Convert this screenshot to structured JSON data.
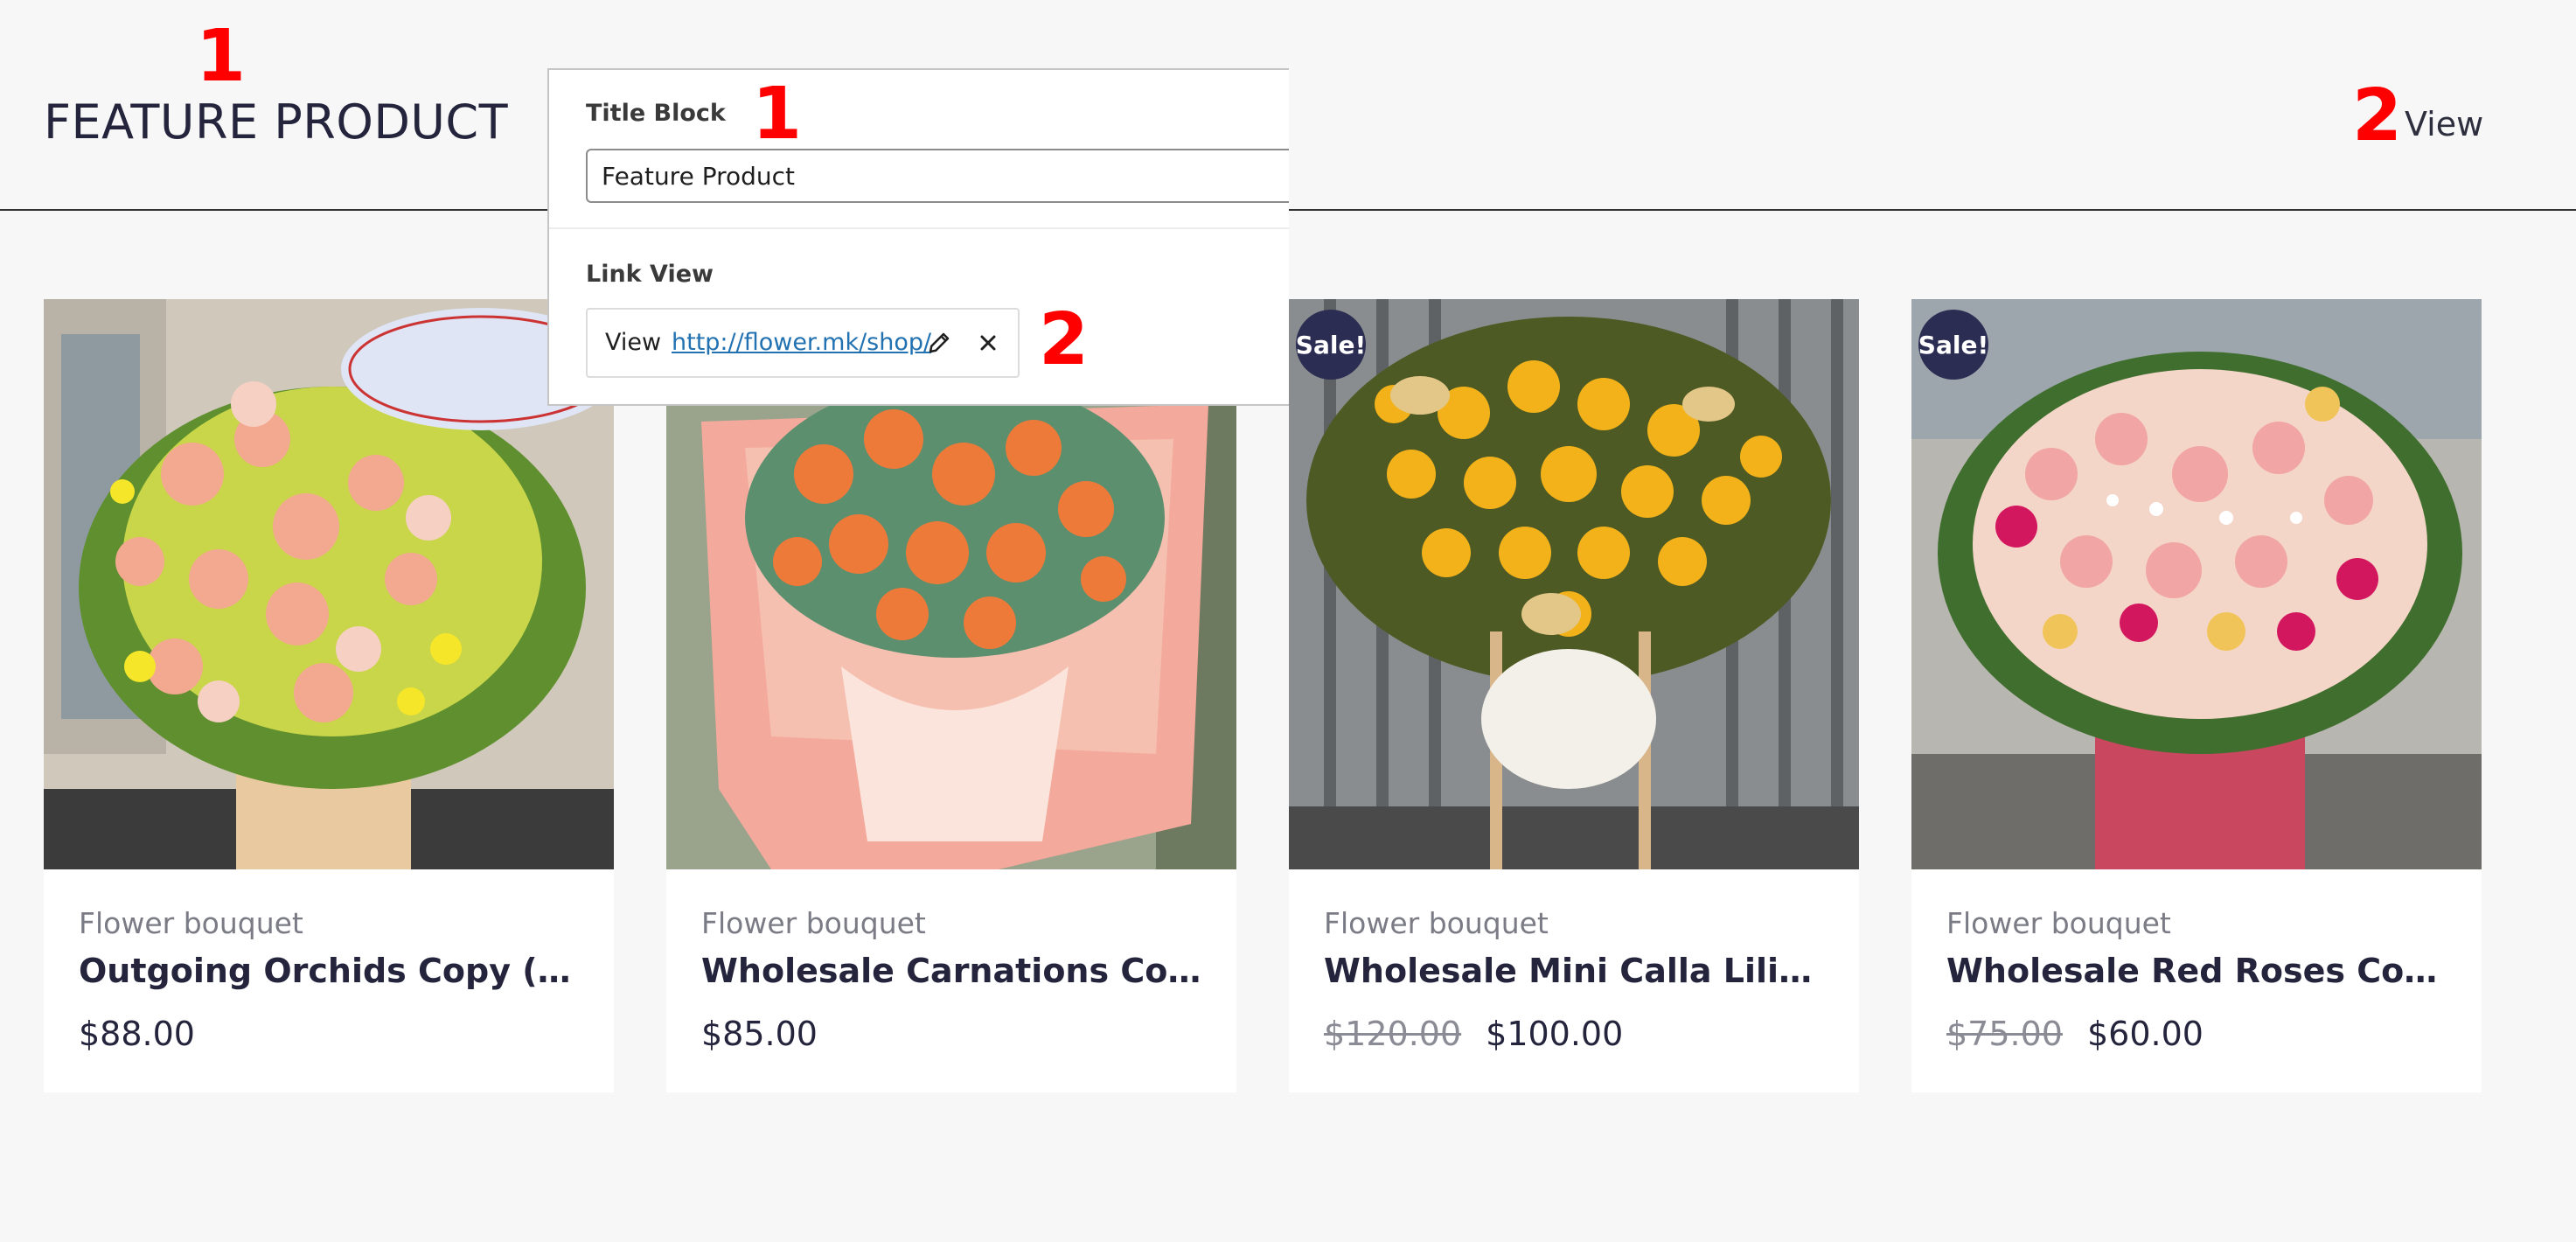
{
  "header": {
    "title": "FEATURE PRODUCT",
    "view_link": "View"
  },
  "markers": {
    "title": "1",
    "panel_title": "1",
    "view": "2",
    "panel_link": "2"
  },
  "panel": {
    "title_block_label": "Title Block",
    "title_block_value": "Feature Product",
    "link_view_label": "Link View",
    "link_prefix": "View",
    "link_url": "http://flower.mk/shop/"
  },
  "products": [
    {
      "category": "Flower bouquet",
      "name": "Outgoing Orchids Copy (Copy)",
      "old_price": "",
      "price": "$88.00",
      "sale": false,
      "image": "pink-yellow-basket"
    },
    {
      "category": "Flower bouquet",
      "name": "Wholesale Carnations Copy…",
      "old_price": "",
      "price": "$85.00",
      "sale": false,
      "image": "orange-rose-bouquet"
    },
    {
      "category": "Flower bouquet",
      "name": "Wholesale Mini Calla Lilies…",
      "old_price": "$120.00",
      "price": "$100.00",
      "sale": true,
      "sale_label": "Sale!",
      "image": "yellow-sunflower-stand"
    },
    {
      "category": "Flower bouquet",
      "name": "Wholesale Red Roses Copy…",
      "old_price": "$75.00",
      "price": "$60.00",
      "sale": true,
      "sale_label": "Sale!",
      "image": "mixed-rose-box"
    }
  ],
  "colors": {
    "text_dark": "#24253d",
    "sale_badge": "#2b2d52",
    "marker": "#ff0000",
    "link": "#2271b1"
  }
}
